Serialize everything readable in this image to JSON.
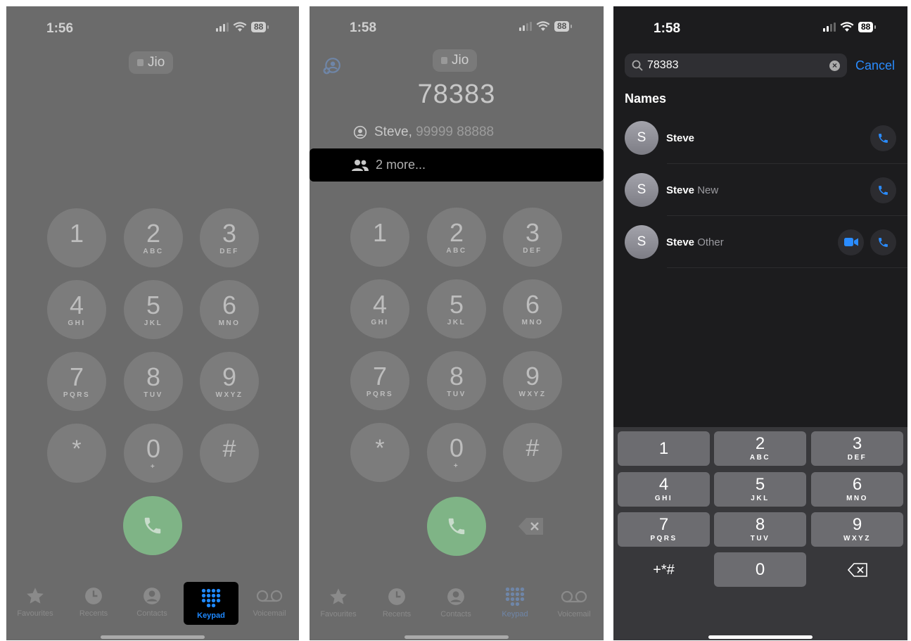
{
  "screen1": {
    "time": "1:56",
    "battery": "88",
    "carrier": "Jio",
    "keys": [
      {
        "d": "1",
        "l": ""
      },
      {
        "d": "2",
        "l": "ABC"
      },
      {
        "d": "3",
        "l": "DEF"
      },
      {
        "d": "4",
        "l": "GHI"
      },
      {
        "d": "5",
        "l": "JKL"
      },
      {
        "d": "6",
        "l": "MNO"
      },
      {
        "d": "7",
        "l": "PQRS"
      },
      {
        "d": "8",
        "l": "TUV"
      },
      {
        "d": "9",
        "l": "WXYZ"
      },
      {
        "d": "*",
        "l": ""
      },
      {
        "d": "0",
        "l": "+"
      },
      {
        "d": "#",
        "l": ""
      }
    ],
    "tabs": [
      "Favourites",
      "Recents",
      "Contacts",
      "Keypad",
      "Voicemail"
    ]
  },
  "screen2": {
    "time": "1:58",
    "battery": "88",
    "carrier": "Jio",
    "dialed": "78383",
    "match_name": "Steve,",
    "match_number": "99999 88888",
    "more": "2 more...",
    "keys": [
      {
        "d": "1",
        "l": ""
      },
      {
        "d": "2",
        "l": "ABC"
      },
      {
        "d": "3",
        "l": "DEF"
      },
      {
        "d": "4",
        "l": "GHI"
      },
      {
        "d": "5",
        "l": "JKL"
      },
      {
        "d": "6",
        "l": "MNO"
      },
      {
        "d": "7",
        "l": "PQRS"
      },
      {
        "d": "8",
        "l": "TUV"
      },
      {
        "d": "9",
        "l": "WXYZ"
      },
      {
        "d": "*",
        "l": ""
      },
      {
        "d": "0",
        "l": "+"
      },
      {
        "d": "#",
        "l": ""
      }
    ],
    "tabs": [
      "Favourites",
      "Recents",
      "Contacts",
      "Keypad",
      "Voicemail"
    ]
  },
  "screen3": {
    "time": "1:58",
    "battery": "88",
    "search_value": "78383",
    "cancel": "Cancel",
    "section": "Names",
    "contacts": [
      {
        "initial": "S",
        "first": "Steve",
        "rest": "",
        "video": false
      },
      {
        "initial": "S",
        "first": "Steve",
        "rest": " New",
        "video": false
      },
      {
        "initial": "S",
        "first": "Steve",
        "rest": " Other",
        "video": true
      }
    ],
    "keys": [
      {
        "d": "1",
        "l": ""
      },
      {
        "d": "2",
        "l": "ABC"
      },
      {
        "d": "3",
        "l": "DEF"
      },
      {
        "d": "4",
        "l": "GHI"
      },
      {
        "d": "5",
        "l": "JKL"
      },
      {
        "d": "6",
        "l": "MNO"
      },
      {
        "d": "7",
        "l": "PQRS"
      },
      {
        "d": "8",
        "l": "TUV"
      },
      {
        "d": "9",
        "l": "WXYZ"
      },
      {
        "d": "+*#",
        "l": ""
      },
      {
        "d": "0",
        "l": ""
      },
      {
        "d": "",
        "l": ""
      }
    ]
  },
  "colors": {
    "accent": "#2a8cff",
    "call_green": "#7fb486"
  }
}
